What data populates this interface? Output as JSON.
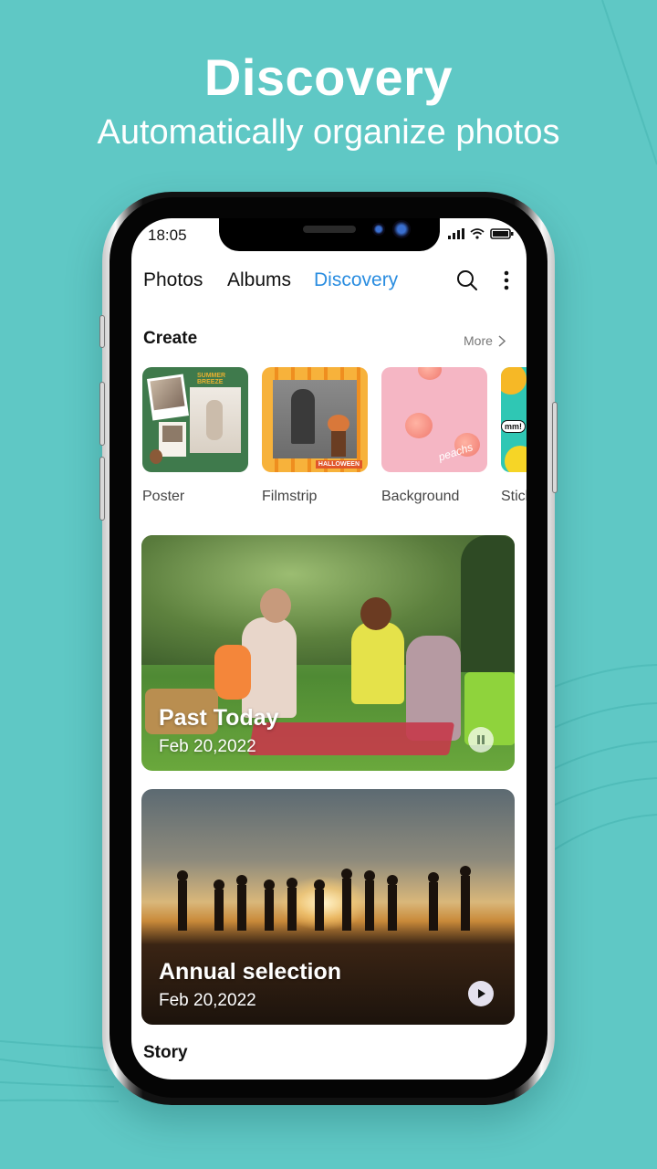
{
  "promo": {
    "headline": "Discovery",
    "subheadline": "Automatically organize photos"
  },
  "colors": {
    "background": "#5fc8c5",
    "accent": "#2a8de0",
    "text_primary": "#111111",
    "text_secondary": "#777777"
  },
  "status_bar": {
    "time": "18:05",
    "icons": [
      "signal-icon",
      "wifi-icon",
      "battery-icon"
    ]
  },
  "nav": {
    "tabs": [
      {
        "label": "Photos",
        "active": false
      },
      {
        "label": "Albums",
        "active": false
      },
      {
        "label": "Discovery",
        "active": true
      }
    ],
    "actions": [
      "search-icon",
      "more-vertical-icon"
    ]
  },
  "create": {
    "title": "Create",
    "more_label": "More",
    "items": [
      {
        "label": "Poster",
        "thumb_text": "SUMMER BREEZE"
      },
      {
        "label": "Filmstrip",
        "thumb_text": "HALLOWEEN"
      },
      {
        "label": "Background",
        "thumb_text": "peachs"
      },
      {
        "label": "Stickers",
        "thumb_text": "mm!"
      }
    ]
  },
  "memories": [
    {
      "title": "Past Today",
      "date": "Feb 20,2022",
      "control": "pause-icon"
    },
    {
      "title": "Annual selection",
      "date": "Feb 20,2022",
      "control": "play-icon"
    }
  ],
  "story": {
    "title": "Story"
  }
}
